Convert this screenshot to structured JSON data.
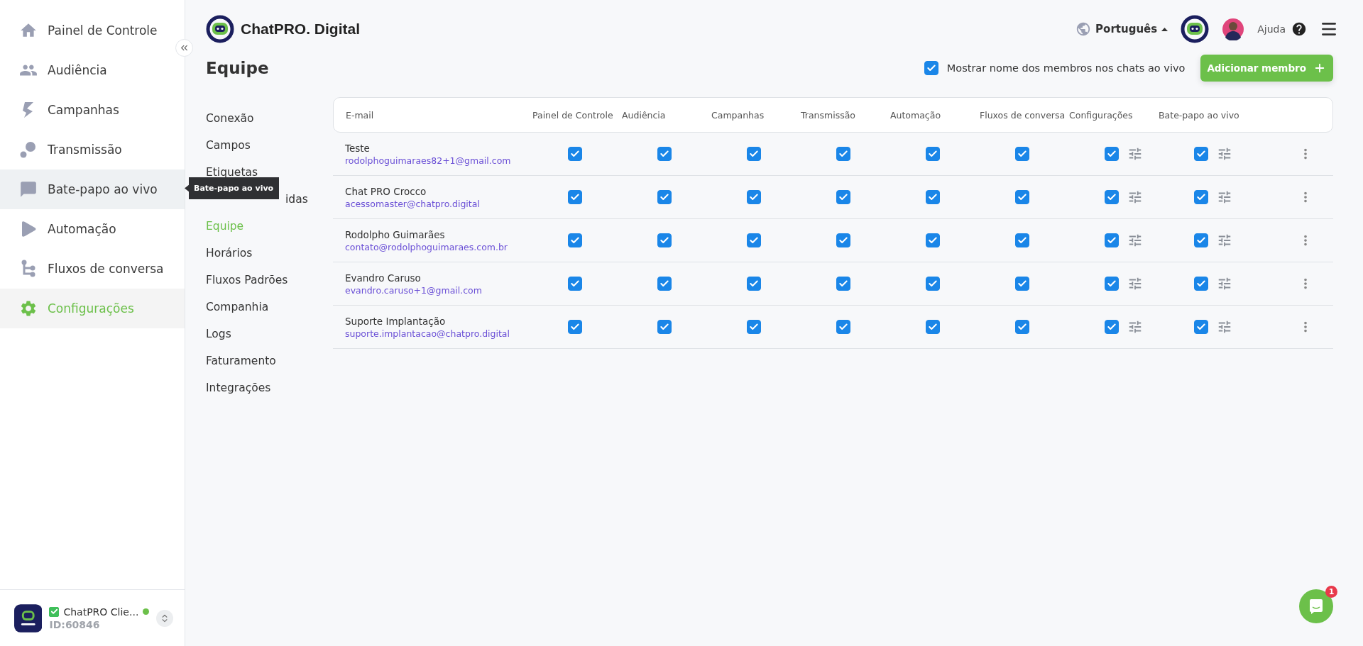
{
  "sidebar": {
    "items": [
      {
        "kind": "home",
        "label": "Painel de Controle",
        "selected": false,
        "hovered": false
      },
      {
        "kind": "audience",
        "label": "Audiência",
        "selected": false,
        "hovered": false
      },
      {
        "kind": "campaigns",
        "label": "Campanhas",
        "selected": false,
        "hovered": false
      },
      {
        "kind": "broadcast",
        "label": "Transmissão",
        "selected": false,
        "hovered": false
      },
      {
        "kind": "chat",
        "label": "Bate-papo ao vivo",
        "selected": false,
        "hovered": true
      },
      {
        "kind": "automation",
        "label": "Automação",
        "selected": false,
        "hovered": false
      },
      {
        "kind": "flows",
        "label": "Fluxos de conversa",
        "selected": false,
        "hovered": false
      },
      {
        "kind": "settings",
        "label": "Configurações",
        "selected": true,
        "hovered": false
      }
    ],
    "tooltip": "Bate-papo ao vivo",
    "account": {
      "name": "ChatPRO Clie...",
      "id": "ID:60846",
      "verified": true,
      "online": true
    }
  },
  "header": {
    "brand": "ChatPRO. Digital",
    "language": "Português",
    "help": "Ajuda"
  },
  "page": {
    "title": "Equipe",
    "show_names": {
      "label": "Mostrar nome dos membros nos chats ao vivo",
      "checked": true
    },
    "add_button": "Adicionar membro"
  },
  "settings_nav": [
    {
      "label": "Conexão",
      "selected": false
    },
    {
      "label": "Campos",
      "selected": false
    },
    {
      "label": "Etiquetas",
      "selected": false
    },
    {
      "label": "idas",
      "selected": false
    },
    {
      "label": "Equipe",
      "selected": true
    },
    {
      "label": "Horários",
      "selected": false
    },
    {
      "label": "Fluxos Padrões",
      "selected": false
    },
    {
      "label": "Companhia",
      "selected": false
    },
    {
      "label": "Logs",
      "selected": false
    },
    {
      "label": "Faturamento",
      "selected": false
    },
    {
      "label": "Integrações",
      "selected": false
    }
  ],
  "table": {
    "columns": [
      {
        "label": "E-mail",
        "kind": "email"
      },
      {
        "label": "Painel de Controle",
        "kind": "plain"
      },
      {
        "label": "Audiência",
        "kind": "plain"
      },
      {
        "label": "Campanhas",
        "kind": "plain"
      },
      {
        "label": "Transmissão",
        "kind": "plain"
      },
      {
        "label": "Automação",
        "kind": "plain"
      },
      {
        "label": "Fluxos de conversa",
        "kind": "plain"
      },
      {
        "label": "Configurações",
        "kind": "settings"
      },
      {
        "label": "Bate-papo ao vivo",
        "kind": "settings"
      }
    ],
    "rows": [
      {
        "name": "Teste",
        "email": "rodolphoguimaraes82+1@gmail.com",
        "permissions": [
          {
            "checked": true
          },
          {
            "checked": true
          },
          {
            "checked": true
          },
          {
            "checked": true
          },
          {
            "checked": true
          },
          {
            "checked": true
          },
          {
            "checked": true
          },
          {
            "checked": true
          }
        ]
      },
      {
        "name": "Chat PRO Crocco",
        "email": "acessomaster@chatpro.digital",
        "permissions": [
          {
            "checked": true
          },
          {
            "checked": true
          },
          {
            "checked": true
          },
          {
            "checked": true
          },
          {
            "checked": true
          },
          {
            "checked": true
          },
          {
            "checked": true
          },
          {
            "checked": true
          }
        ]
      },
      {
        "name": "Rodolpho Guimarães",
        "email": "contato@rodolphoguimaraes.com.br",
        "permissions": [
          {
            "checked": true
          },
          {
            "checked": true
          },
          {
            "checked": true
          },
          {
            "checked": true
          },
          {
            "checked": true
          },
          {
            "checked": true
          },
          {
            "checked": true
          },
          {
            "checked": true
          }
        ]
      },
      {
        "name": "Evandro Caruso",
        "email": "evandro.caruso+1@gmail.com",
        "permissions": [
          {
            "checked": true
          },
          {
            "checked": true
          },
          {
            "checked": true
          },
          {
            "checked": true
          },
          {
            "checked": true
          },
          {
            "checked": true
          },
          {
            "checked": true
          },
          {
            "checked": true
          }
        ]
      },
      {
        "name": "Suporte Implantação",
        "email": "suporte.implantacao@chatpro.digital",
        "permissions": [
          {
            "checked": true
          },
          {
            "checked": true
          },
          {
            "checked": true
          },
          {
            "checked": true
          },
          {
            "checked": true
          },
          {
            "checked": true
          },
          {
            "checked": true
          },
          {
            "checked": true
          }
        ]
      }
    ]
  },
  "chat_widget": {
    "badge": "1"
  }
}
